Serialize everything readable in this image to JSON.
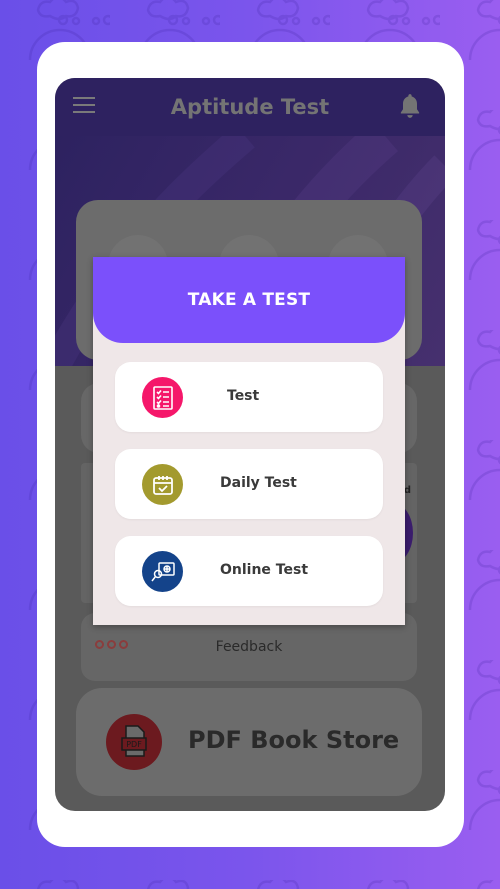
{
  "app": {
    "title": "Aptitude Test"
  },
  "dialog": {
    "title": "TAKE A TEST",
    "options": [
      {
        "label": "Test",
        "icon": "checklist-icon",
        "color": "#f5176a"
      },
      {
        "label": "Daily Test",
        "icon": "calendar-check-icon",
        "color": "#a39a2e"
      },
      {
        "label": "Online Test",
        "icon": "online-exam-icon",
        "color": "#14438a"
      }
    ]
  },
  "background_cards": {
    "feedback_label": "Feedback",
    "pdf_store_label": "PDF Book Store",
    "partial_letter": "d"
  },
  "colors": {
    "accent": "#7b50fb",
    "appbar": "#2e2260",
    "dialog_bg": "#efe7e8"
  }
}
